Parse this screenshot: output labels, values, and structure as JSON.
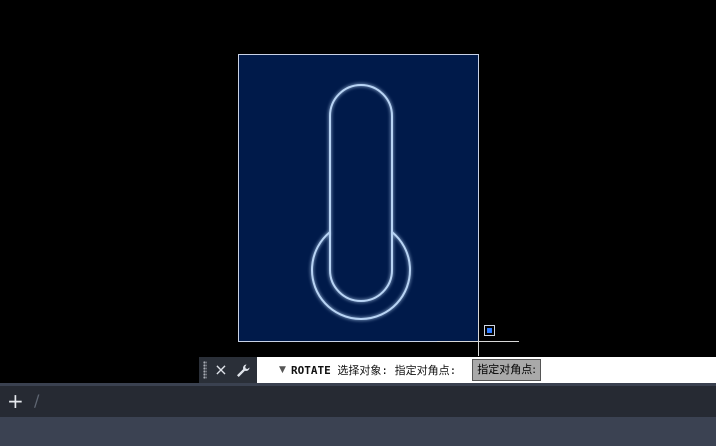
{
  "command_line": {
    "command_name": "ROTATE",
    "prompt_text": "选择对象: 指定对角点:",
    "tooltip_text": "指定对角点:",
    "close_icon": "×",
    "settings_icon": "wrench"
  },
  "layout_tabs": {
    "add_icon": "+",
    "separator": "/"
  },
  "colors": {
    "background": "#000000",
    "selection_fill": "#001a4a",
    "outline": "#b8d4f5",
    "pickbox": "#2f7bff",
    "command_bg": "#ffffff",
    "tab_bar_bg": "#262a33",
    "status_bar_bg": "#3b4252"
  }
}
